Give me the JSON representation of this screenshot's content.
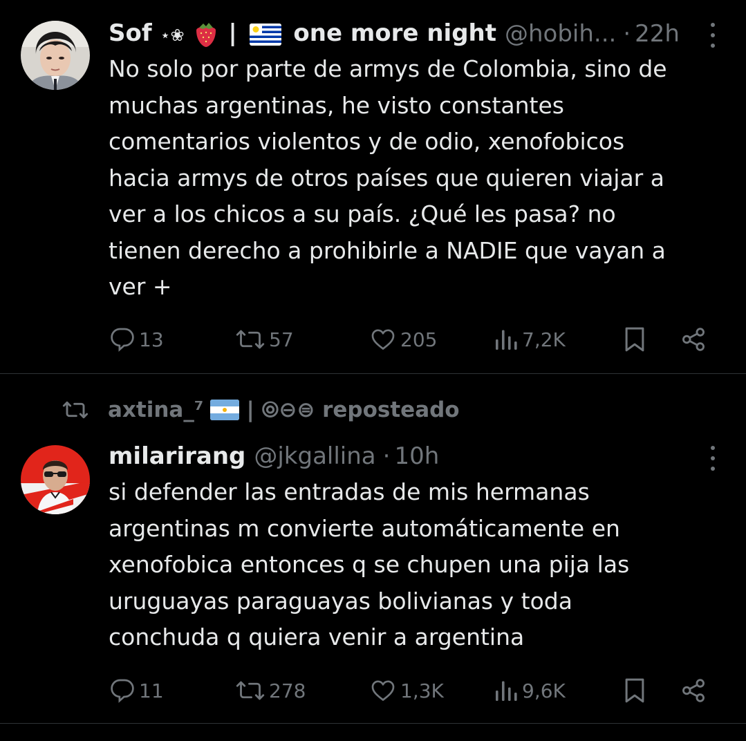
{
  "colors": {
    "background": "#000000",
    "text_primary": "#e7e9ea",
    "text_secondary": "#71767b",
    "divider": "#2f3336"
  },
  "tweets": [
    {
      "author": {
        "name": "Sof",
        "name_decorations": "⋆❀🍓|",
        "name_suffix": "| one more night",
        "handle": "@hobih...",
        "avatar_icon": "avatar-photo"
      },
      "dot": "·",
      "time": "22h",
      "text": "No solo por parte de armys de Colombia, sino de\nmuchas argentinas, he visto constantes\ncomentarios violentos y de odio, xenofobicos\nhacia armys de otros países que quieren viajar a\nver a los chicos a su país. ¿Qué les pasa? no\ntienen derecho a prohibirle a NADIE que vayan a\nver +",
      "stats": {
        "replies": "13",
        "reposts": "57",
        "likes": "205",
        "views": "7,2K"
      }
    },
    {
      "repost_banner": {
        "user": "axtina_⁷",
        "suffix": "| ⦾⊖⊜ reposteado"
      },
      "author": {
        "name": "milarirang",
        "handle": "@jkgallina",
        "avatar_icon": "avatar-photo"
      },
      "dot": "·",
      "time": "10h",
      "text": "si defender las entradas de mis hermanas\nargentinas m convierte automáticamente en\nxenofobica entonces q se chupen una pija las\nuruguayas paraguayas bolivianas y toda\nconchuda q quiera venir a argentina",
      "stats": {
        "replies": "11",
        "reposts": "278",
        "likes": "1,3K",
        "views": "9,6K"
      }
    }
  ]
}
